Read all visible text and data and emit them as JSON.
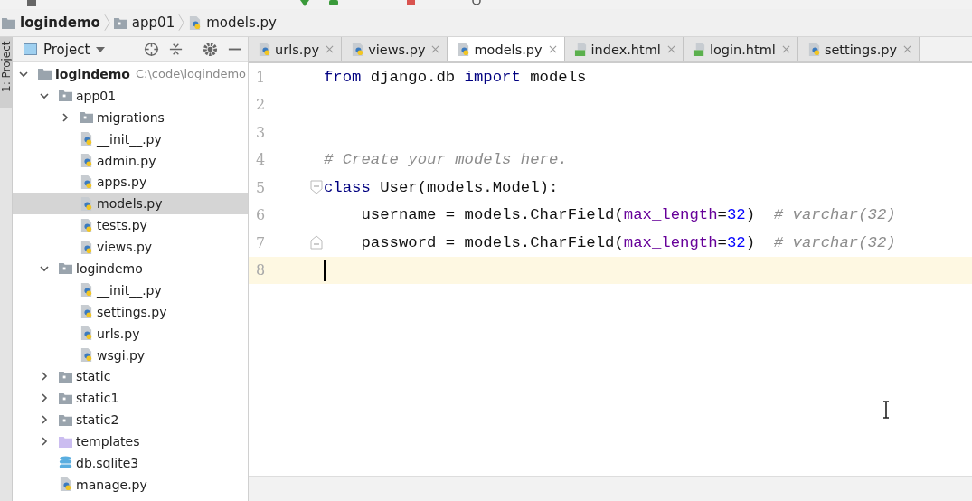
{
  "breadcrumb": [
    {
      "label": "logindemo",
      "kind": "root"
    },
    {
      "label": "app01",
      "kind": "package"
    },
    {
      "label": "models.py",
      "kind": "python"
    }
  ],
  "tool_window_tab": {
    "label": "1: Project",
    "selected": true
  },
  "project": {
    "title": "Project",
    "tree": [
      {
        "label": "logindemo",
        "path": "C:\\code\\logindemo",
        "kind": "root",
        "expanded": true,
        "selected": false,
        "children": [
          {
            "label": "app01",
            "kind": "package",
            "expanded": true,
            "selected": false,
            "children": [
              {
                "label": "migrations",
                "kind": "package",
                "expanded": false,
                "selected": false
              },
              {
                "label": "__init__.py",
                "kind": "python",
                "selected": false
              },
              {
                "label": "admin.py",
                "kind": "python",
                "selected": false
              },
              {
                "label": "apps.py",
                "kind": "python",
                "selected": false
              },
              {
                "label": "models.py",
                "kind": "python",
                "selected": true
              },
              {
                "label": "tests.py",
                "kind": "python",
                "selected": false
              },
              {
                "label": "views.py",
                "kind": "python",
                "selected": false
              }
            ]
          },
          {
            "label": "logindemo",
            "kind": "package",
            "expanded": true,
            "selected": false,
            "children": [
              {
                "label": "__init__.py",
                "kind": "python",
                "selected": false
              },
              {
                "label": "settings.py",
                "kind": "python",
                "selected": false
              },
              {
                "label": "urls.py",
                "kind": "python",
                "selected": false
              },
              {
                "label": "wsgi.py",
                "kind": "python",
                "selected": false
              }
            ]
          },
          {
            "label": "static",
            "kind": "package",
            "expanded": false,
            "selected": false
          },
          {
            "label": "static1",
            "kind": "package",
            "expanded": false,
            "selected": false
          },
          {
            "label": "static2",
            "kind": "package",
            "expanded": false,
            "selected": false
          },
          {
            "label": "templates",
            "kind": "templates",
            "expanded": false,
            "selected": false
          },
          {
            "label": "db.sqlite3",
            "kind": "database",
            "selected": false
          },
          {
            "label": "manage.py",
            "kind": "python",
            "selected": false
          }
        ]
      }
    ]
  },
  "tabs": [
    {
      "label": "urls.py",
      "kind": "python",
      "selected": false
    },
    {
      "label": "views.py",
      "kind": "python",
      "selected": false
    },
    {
      "label": "models.py",
      "kind": "python",
      "selected": true
    },
    {
      "label": "index.html",
      "kind": "html",
      "selected": false
    },
    {
      "label": "login.html",
      "kind": "html",
      "selected": false
    },
    {
      "label": "settings.py",
      "kind": "python",
      "selected": false
    }
  ],
  "editor": {
    "lines": [
      {
        "number": "1",
        "current": false,
        "fold_start": false,
        "fold_end": false,
        "tokens": [
          {
            "text": "from",
            "kind": "keyword"
          },
          {
            "text": " django.db ",
            "kind": "plain"
          },
          {
            "text": "import",
            "kind": "keyword"
          },
          {
            "text": " models",
            "kind": "plain"
          }
        ]
      },
      {
        "number": "2",
        "current": false,
        "fold_start": false,
        "fold_end": false
      },
      {
        "number": "3",
        "current": false,
        "fold_start": false,
        "fold_end": false
      },
      {
        "number": "4",
        "current": false,
        "fold_start": false,
        "fold_end": false,
        "tokens": [
          {
            "text": "# Create your models here.",
            "kind": "comment"
          }
        ]
      },
      {
        "number": "5",
        "current": false,
        "fold_start": true,
        "fold_end": false,
        "tokens": [
          {
            "text": "class",
            "kind": "keyword"
          },
          {
            "text": " User(models.Model):",
            "kind": "plain"
          }
        ]
      },
      {
        "number": "6",
        "current": false,
        "fold_start": false,
        "fold_end": false,
        "tokens": [
          {
            "text": "    username = models.CharField(",
            "kind": "plain"
          },
          {
            "text": "max_length",
            "kind": "param"
          },
          {
            "text": "=",
            "kind": "plain"
          },
          {
            "text": "32",
            "kind": "number"
          },
          {
            "text": ")  ",
            "kind": "plain"
          },
          {
            "text": "# varchar(32)",
            "kind": "comment"
          }
        ]
      },
      {
        "number": "7",
        "current": false,
        "fold_start": false,
        "fold_end": true,
        "tokens": [
          {
            "text": "    password = models.CharField(",
            "kind": "plain"
          },
          {
            "text": "max_length",
            "kind": "param"
          },
          {
            "text": "=",
            "kind": "plain"
          },
          {
            "text": "32",
            "kind": "number"
          },
          {
            "text": ")  ",
            "kind": "plain"
          },
          {
            "text": "# varchar(32)",
            "kind": "comment"
          }
        ]
      },
      {
        "number": "8",
        "current": true,
        "fold_start": false,
        "fold_end": false
      }
    ]
  }
}
